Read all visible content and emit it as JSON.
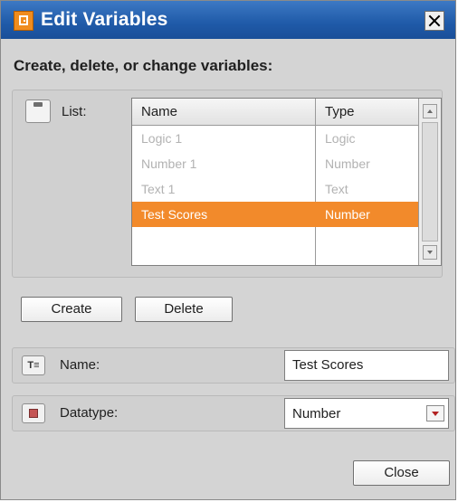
{
  "window": {
    "title": "Edit Variables",
    "close_icon": "close-icon"
  },
  "heading": "Create, delete, or change variables:",
  "list": {
    "label": "List:",
    "columns": [
      "Name",
      "Type"
    ],
    "rows": [
      {
        "name": "Logic 1",
        "type": "Logic",
        "selected": false
      },
      {
        "name": "Number 1",
        "type": "Number",
        "selected": false
      },
      {
        "name": "Text 1",
        "type": "Text",
        "selected": false
      },
      {
        "name": "Test Scores",
        "type": "Number",
        "selected": true
      }
    ],
    "selected_color": "#f28a2b"
  },
  "buttons": {
    "create": "Create",
    "delete": "Delete",
    "close": "Close"
  },
  "name_field": {
    "label": "Name:",
    "value": "Test Scores"
  },
  "datatype_field": {
    "label": "Datatype:",
    "value": "Number"
  }
}
